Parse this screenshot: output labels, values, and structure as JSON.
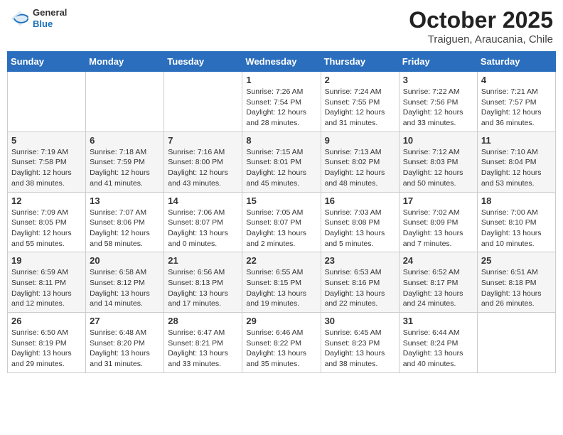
{
  "header": {
    "logo": {
      "general": "General",
      "blue": "Blue"
    },
    "title": "October 2025",
    "location": "Traiguen, Araucania, Chile"
  },
  "weekdays": [
    "Sunday",
    "Monday",
    "Tuesday",
    "Wednesday",
    "Thursday",
    "Friday",
    "Saturday"
  ],
  "weeks": [
    [
      {
        "day": "",
        "info": ""
      },
      {
        "day": "",
        "info": ""
      },
      {
        "day": "",
        "info": ""
      },
      {
        "day": "1",
        "info": "Sunrise: 7:26 AM\nSunset: 7:54 PM\nDaylight: 12 hours and 28 minutes."
      },
      {
        "day": "2",
        "info": "Sunrise: 7:24 AM\nSunset: 7:55 PM\nDaylight: 12 hours and 31 minutes."
      },
      {
        "day": "3",
        "info": "Sunrise: 7:22 AM\nSunset: 7:56 PM\nDaylight: 12 hours and 33 minutes."
      },
      {
        "day": "4",
        "info": "Sunrise: 7:21 AM\nSunset: 7:57 PM\nDaylight: 12 hours and 36 minutes."
      }
    ],
    [
      {
        "day": "5",
        "info": "Sunrise: 7:19 AM\nSunset: 7:58 PM\nDaylight: 12 hours and 38 minutes."
      },
      {
        "day": "6",
        "info": "Sunrise: 7:18 AM\nSunset: 7:59 PM\nDaylight: 12 hours and 41 minutes."
      },
      {
        "day": "7",
        "info": "Sunrise: 7:16 AM\nSunset: 8:00 PM\nDaylight: 12 hours and 43 minutes."
      },
      {
        "day": "8",
        "info": "Sunrise: 7:15 AM\nSunset: 8:01 PM\nDaylight: 12 hours and 45 minutes."
      },
      {
        "day": "9",
        "info": "Sunrise: 7:13 AM\nSunset: 8:02 PM\nDaylight: 12 hours and 48 minutes."
      },
      {
        "day": "10",
        "info": "Sunrise: 7:12 AM\nSunset: 8:03 PM\nDaylight: 12 hours and 50 minutes."
      },
      {
        "day": "11",
        "info": "Sunrise: 7:10 AM\nSunset: 8:04 PM\nDaylight: 12 hours and 53 minutes."
      }
    ],
    [
      {
        "day": "12",
        "info": "Sunrise: 7:09 AM\nSunset: 8:05 PM\nDaylight: 12 hours and 55 minutes."
      },
      {
        "day": "13",
        "info": "Sunrise: 7:07 AM\nSunset: 8:06 PM\nDaylight: 12 hours and 58 minutes."
      },
      {
        "day": "14",
        "info": "Sunrise: 7:06 AM\nSunset: 8:07 PM\nDaylight: 13 hours and 0 minutes."
      },
      {
        "day": "15",
        "info": "Sunrise: 7:05 AM\nSunset: 8:07 PM\nDaylight: 13 hours and 2 minutes."
      },
      {
        "day": "16",
        "info": "Sunrise: 7:03 AM\nSunset: 8:08 PM\nDaylight: 13 hours and 5 minutes."
      },
      {
        "day": "17",
        "info": "Sunrise: 7:02 AM\nSunset: 8:09 PM\nDaylight: 13 hours and 7 minutes."
      },
      {
        "day": "18",
        "info": "Sunrise: 7:00 AM\nSunset: 8:10 PM\nDaylight: 13 hours and 10 minutes."
      }
    ],
    [
      {
        "day": "19",
        "info": "Sunrise: 6:59 AM\nSunset: 8:11 PM\nDaylight: 13 hours and 12 minutes."
      },
      {
        "day": "20",
        "info": "Sunrise: 6:58 AM\nSunset: 8:12 PM\nDaylight: 13 hours and 14 minutes."
      },
      {
        "day": "21",
        "info": "Sunrise: 6:56 AM\nSunset: 8:13 PM\nDaylight: 13 hours and 17 minutes."
      },
      {
        "day": "22",
        "info": "Sunrise: 6:55 AM\nSunset: 8:15 PM\nDaylight: 13 hours and 19 minutes."
      },
      {
        "day": "23",
        "info": "Sunrise: 6:53 AM\nSunset: 8:16 PM\nDaylight: 13 hours and 22 minutes."
      },
      {
        "day": "24",
        "info": "Sunrise: 6:52 AM\nSunset: 8:17 PM\nDaylight: 13 hours and 24 minutes."
      },
      {
        "day": "25",
        "info": "Sunrise: 6:51 AM\nSunset: 8:18 PM\nDaylight: 13 hours and 26 minutes."
      }
    ],
    [
      {
        "day": "26",
        "info": "Sunrise: 6:50 AM\nSunset: 8:19 PM\nDaylight: 13 hours and 29 minutes."
      },
      {
        "day": "27",
        "info": "Sunrise: 6:48 AM\nSunset: 8:20 PM\nDaylight: 13 hours and 31 minutes."
      },
      {
        "day": "28",
        "info": "Sunrise: 6:47 AM\nSunset: 8:21 PM\nDaylight: 13 hours and 33 minutes."
      },
      {
        "day": "29",
        "info": "Sunrise: 6:46 AM\nSunset: 8:22 PM\nDaylight: 13 hours and 35 minutes."
      },
      {
        "day": "30",
        "info": "Sunrise: 6:45 AM\nSunset: 8:23 PM\nDaylight: 13 hours and 38 minutes."
      },
      {
        "day": "31",
        "info": "Sunrise: 6:44 AM\nSunset: 8:24 PM\nDaylight: 13 hours and 40 minutes."
      },
      {
        "day": "",
        "info": ""
      }
    ]
  ]
}
